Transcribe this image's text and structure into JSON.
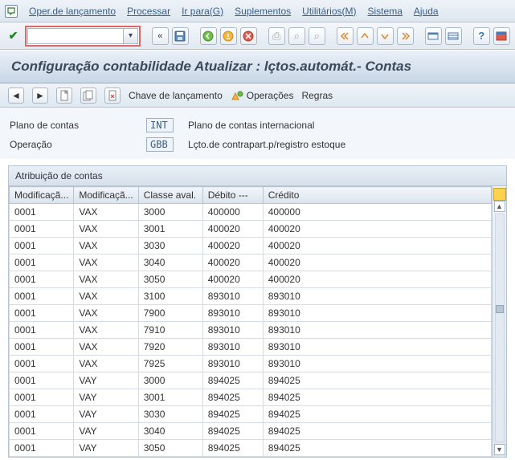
{
  "menu": {
    "items": [
      "Oper.de lançamento",
      "Processar",
      "Ir para(G)",
      "Suplementos",
      "Utilitários(M)",
      "Sistema",
      "Ajuda"
    ]
  },
  "cmd": {
    "value": ""
  },
  "title": "Configuração contabilidade Atualizar : lçtos.automát.- Contas",
  "subtoolbar": {
    "posting_key": "Chave de lançamento",
    "operations": "Operações",
    "rules": "Regras"
  },
  "fields": {
    "chart_label": "Plano de contas",
    "chart_value": "INT",
    "chart_desc": "Plano de contas internacional",
    "trans_label": "Operação",
    "trans_value": "GBB",
    "trans_desc": "Lçto.de contrapart.p/registro estoque"
  },
  "section_title": "Atribuição de contas",
  "columns": [
    "Modificaçã...",
    "Modificaçã...",
    "Classe aval.",
    "Débito ---",
    "Crédito"
  ],
  "rows": [
    {
      "c1": "0001",
      "c2": "VAX",
      "c3": "3000",
      "c4": "400000",
      "c5": "400000"
    },
    {
      "c1": "0001",
      "c2": "VAX",
      "c3": "3001",
      "c4": "400020",
      "c5": "400020"
    },
    {
      "c1": "0001",
      "c2": "VAX",
      "c3": "3030",
      "c4": "400020",
      "c5": "400020"
    },
    {
      "c1": "0001",
      "c2": "VAX",
      "c3": "3040",
      "c4": "400020",
      "c5": "400020"
    },
    {
      "c1": "0001",
      "c2": "VAX",
      "c3": "3050",
      "c4": "400020",
      "c5": "400020"
    },
    {
      "c1": "0001",
      "c2": "VAX",
      "c3": "3100",
      "c4": "893010",
      "c5": "893010"
    },
    {
      "c1": "0001",
      "c2": "VAX",
      "c3": "7900",
      "c4": "893010",
      "c5": "893010"
    },
    {
      "c1": "0001",
      "c2": "VAX",
      "c3": "7910",
      "c4": "893010",
      "c5": "893010"
    },
    {
      "c1": "0001",
      "c2": "VAX",
      "c3": "7920",
      "c4": "893010",
      "c5": "893010"
    },
    {
      "c1": "0001",
      "c2": "VAX",
      "c3": "7925",
      "c4": "893010",
      "c5": "893010"
    },
    {
      "c1": "0001",
      "c2": "VAY",
      "c3": "3000",
      "c4": "894025",
      "c5": "894025"
    },
    {
      "c1": "0001",
      "c2": "VAY",
      "c3": "3001",
      "c4": "894025",
      "c5": "894025"
    },
    {
      "c1": "0001",
      "c2": "VAY",
      "c3": "3030",
      "c4": "894025",
      "c5": "894025"
    },
    {
      "c1": "0001",
      "c2": "VAY",
      "c3": "3040",
      "c4": "894025",
      "c5": "894025"
    },
    {
      "c1": "0001",
      "c2": "VAY",
      "c3": "3050",
      "c4": "894025",
      "c5": "894025"
    }
  ]
}
